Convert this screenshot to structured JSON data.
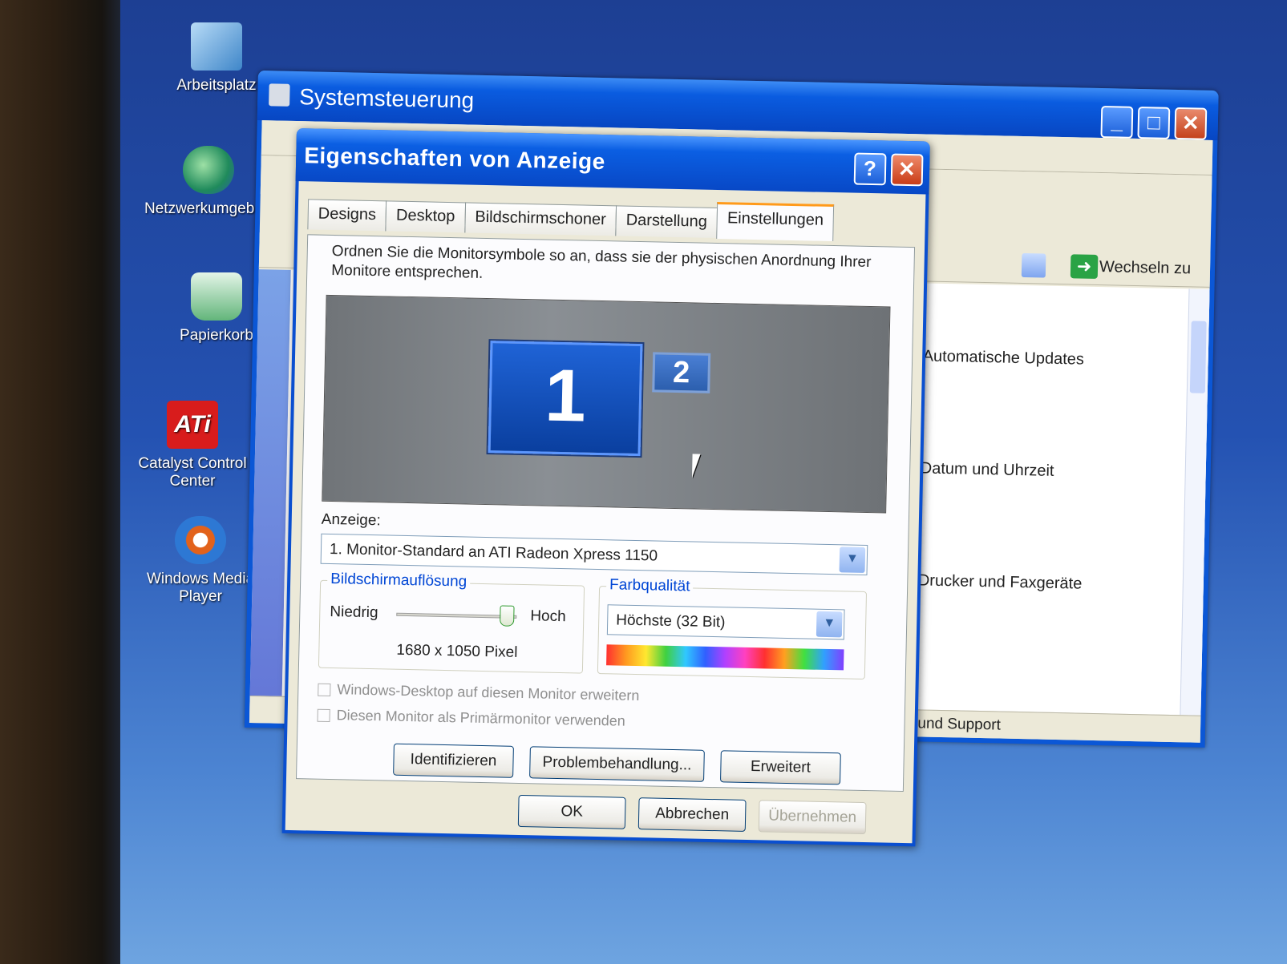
{
  "desktop": {
    "icons": [
      {
        "label": "Arbeitsplatz",
        "icon": "computer-icon"
      },
      {
        "label": "Netzwerkumgebung",
        "icon": "network-icon"
      },
      {
        "label": "Papierkorb",
        "icon": "recycle-bin-icon"
      },
      {
        "label": "Catalyst Control Center",
        "icon": "ati-icon",
        "glyph": "ATi"
      },
      {
        "label": "Windows Media Player",
        "icon": "media-player-icon"
      }
    ]
  },
  "control_panel": {
    "title": "Systemsteuerung",
    "controls": {
      "minimize": "_",
      "maximize": "□",
      "close": "✕"
    },
    "go_label": "Wechseln zu",
    "items": [
      "Automatische Updates",
      "Datum und Uhrzeit",
      "Drucker und Faxgeräte"
    ],
    "status": "Hilfe und Support"
  },
  "dialog": {
    "title": "Eigenschaften von Anzeige",
    "help_button": "?",
    "close_button": "✕",
    "tabs": [
      "Designs",
      "Desktop",
      "Bildschirmschoner",
      "Darstellung",
      "Einstellungen"
    ],
    "active_tab": "Einstellungen",
    "intro": "Ordnen Sie die Monitorsymbole so an, dass sie der physischen Anordnung Ihrer Monitore entsprechen.",
    "monitors": [
      {
        "number": "1"
      },
      {
        "number": "2"
      }
    ],
    "display_label": "Anzeige:",
    "display_value": "1. Monitor-Standard an ATI Radeon Xpress 1150",
    "resolution": {
      "group_title": "Bildschirmauflösung",
      "low_label": "Niedrig",
      "high_label": "Hoch",
      "value": "1680 x 1050 Pixel",
      "slider_level": 0.92
    },
    "color": {
      "group_title": "Farbqualität",
      "value": "Höchste (32 Bit)"
    },
    "checkboxes": [
      "Windows-Desktop auf diesen Monitor erweitern",
      "Diesen Monitor als Primärmonitor verwenden"
    ],
    "buttons": {
      "identify": "Identifizieren",
      "troubleshoot": "Problembehandlung...",
      "advanced": "Erweitert"
    },
    "footer": {
      "ok": "OK",
      "cancel": "Abbrechen",
      "apply": "Übernehmen"
    }
  }
}
